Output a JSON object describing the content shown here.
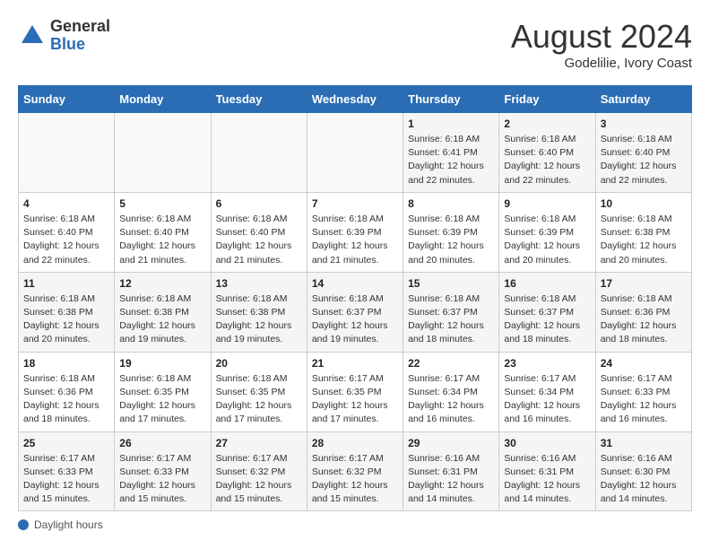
{
  "header": {
    "logo_general": "General",
    "logo_blue": "Blue",
    "month_year": "August 2024",
    "location": "Godelilie, Ivory Coast"
  },
  "weekdays": [
    "Sunday",
    "Monday",
    "Tuesday",
    "Wednesday",
    "Thursday",
    "Friday",
    "Saturday"
  ],
  "weeks": [
    [
      {
        "day": "",
        "info": ""
      },
      {
        "day": "",
        "info": ""
      },
      {
        "day": "",
        "info": ""
      },
      {
        "day": "",
        "info": ""
      },
      {
        "day": "1",
        "info": "Sunrise: 6:18 AM\nSunset: 6:41 PM\nDaylight: 12 hours\nand 22 minutes."
      },
      {
        "day": "2",
        "info": "Sunrise: 6:18 AM\nSunset: 6:40 PM\nDaylight: 12 hours\nand 22 minutes."
      },
      {
        "day": "3",
        "info": "Sunrise: 6:18 AM\nSunset: 6:40 PM\nDaylight: 12 hours\nand 22 minutes."
      }
    ],
    [
      {
        "day": "4",
        "info": "Sunrise: 6:18 AM\nSunset: 6:40 PM\nDaylight: 12 hours\nand 22 minutes."
      },
      {
        "day": "5",
        "info": "Sunrise: 6:18 AM\nSunset: 6:40 PM\nDaylight: 12 hours\nand 21 minutes."
      },
      {
        "day": "6",
        "info": "Sunrise: 6:18 AM\nSunset: 6:40 PM\nDaylight: 12 hours\nand 21 minutes."
      },
      {
        "day": "7",
        "info": "Sunrise: 6:18 AM\nSunset: 6:39 PM\nDaylight: 12 hours\nand 21 minutes."
      },
      {
        "day": "8",
        "info": "Sunrise: 6:18 AM\nSunset: 6:39 PM\nDaylight: 12 hours\nand 20 minutes."
      },
      {
        "day": "9",
        "info": "Sunrise: 6:18 AM\nSunset: 6:39 PM\nDaylight: 12 hours\nand 20 minutes."
      },
      {
        "day": "10",
        "info": "Sunrise: 6:18 AM\nSunset: 6:38 PM\nDaylight: 12 hours\nand 20 minutes."
      }
    ],
    [
      {
        "day": "11",
        "info": "Sunrise: 6:18 AM\nSunset: 6:38 PM\nDaylight: 12 hours\nand 20 minutes."
      },
      {
        "day": "12",
        "info": "Sunrise: 6:18 AM\nSunset: 6:38 PM\nDaylight: 12 hours\nand 19 minutes."
      },
      {
        "day": "13",
        "info": "Sunrise: 6:18 AM\nSunset: 6:38 PM\nDaylight: 12 hours\nand 19 minutes."
      },
      {
        "day": "14",
        "info": "Sunrise: 6:18 AM\nSunset: 6:37 PM\nDaylight: 12 hours\nand 19 minutes."
      },
      {
        "day": "15",
        "info": "Sunrise: 6:18 AM\nSunset: 6:37 PM\nDaylight: 12 hours\nand 18 minutes."
      },
      {
        "day": "16",
        "info": "Sunrise: 6:18 AM\nSunset: 6:37 PM\nDaylight: 12 hours\nand 18 minutes."
      },
      {
        "day": "17",
        "info": "Sunrise: 6:18 AM\nSunset: 6:36 PM\nDaylight: 12 hours\nand 18 minutes."
      }
    ],
    [
      {
        "day": "18",
        "info": "Sunrise: 6:18 AM\nSunset: 6:36 PM\nDaylight: 12 hours\nand 18 minutes."
      },
      {
        "day": "19",
        "info": "Sunrise: 6:18 AM\nSunset: 6:35 PM\nDaylight: 12 hours\nand 17 minutes."
      },
      {
        "day": "20",
        "info": "Sunrise: 6:18 AM\nSunset: 6:35 PM\nDaylight: 12 hours\nand 17 minutes."
      },
      {
        "day": "21",
        "info": "Sunrise: 6:17 AM\nSunset: 6:35 PM\nDaylight: 12 hours\nand 17 minutes."
      },
      {
        "day": "22",
        "info": "Sunrise: 6:17 AM\nSunset: 6:34 PM\nDaylight: 12 hours\nand 16 minutes."
      },
      {
        "day": "23",
        "info": "Sunrise: 6:17 AM\nSunset: 6:34 PM\nDaylight: 12 hours\nand 16 minutes."
      },
      {
        "day": "24",
        "info": "Sunrise: 6:17 AM\nSunset: 6:33 PM\nDaylight: 12 hours\nand 16 minutes."
      }
    ],
    [
      {
        "day": "25",
        "info": "Sunrise: 6:17 AM\nSunset: 6:33 PM\nDaylight: 12 hours\nand 15 minutes."
      },
      {
        "day": "26",
        "info": "Sunrise: 6:17 AM\nSunset: 6:33 PM\nDaylight: 12 hours\nand 15 minutes."
      },
      {
        "day": "27",
        "info": "Sunrise: 6:17 AM\nSunset: 6:32 PM\nDaylight: 12 hours\nand 15 minutes."
      },
      {
        "day": "28",
        "info": "Sunrise: 6:17 AM\nSunset: 6:32 PM\nDaylight: 12 hours\nand 15 minutes."
      },
      {
        "day": "29",
        "info": "Sunrise: 6:16 AM\nSunset: 6:31 PM\nDaylight: 12 hours\nand 14 minutes."
      },
      {
        "day": "30",
        "info": "Sunrise: 6:16 AM\nSunset: 6:31 PM\nDaylight: 12 hours\nand 14 minutes."
      },
      {
        "day": "31",
        "info": "Sunrise: 6:16 AM\nSunset: 6:30 PM\nDaylight: 12 hours\nand 14 minutes."
      }
    ]
  ],
  "footer": {
    "label": "Daylight hours"
  }
}
